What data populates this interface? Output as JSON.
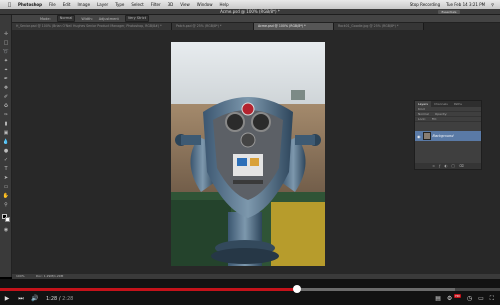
{
  "mac_menu": {
    "apple_icon": "apple-icon",
    "app_name": "Photoshop",
    "items": [
      "File",
      "Edit",
      "Image",
      "Layer",
      "Type",
      "Select",
      "Filter",
      "3D",
      "View",
      "Window",
      "Help"
    ],
    "clock": "Tue Feb 14  3:21 PM",
    "recording_label": "Stop Recording"
  },
  "app_bar": {
    "document_title": "Acme.psd @ 100% (RGB/8*) *",
    "workspace": "Essentials"
  },
  "options_bar": {
    "mode_label": "Mode:",
    "mode_value": "Normal",
    "width_label": "Width:",
    "adjustment_label": "Adjustment",
    "adjustment_value": "Very Strict"
  },
  "tabs": [
    {
      "label": "H_Senior.psd @ 100% (Brian O'Neil Hughes Senior Product Manager, Photoshop, RGB/8#) *",
      "active": false
    },
    {
      "label": "Patch.psd @ 25% (RGB/8*) *",
      "active": false
    },
    {
      "label": "Acme.psd @ 100% (RGB/8*) *",
      "active": true
    },
    {
      "label": "Rock01_Goodie.jpg @ 25% (RGB/8*) *",
      "active": false
    }
  ],
  "layers_panel": {
    "tabs": [
      "Layers",
      "Channels",
      "Paths"
    ],
    "kind_label": "Kind",
    "blend_mode": "Normal",
    "opacity_label": "Opacity:",
    "lock_label": "Lock:",
    "fill_label": "Fill:",
    "layer_name": "Background"
  },
  "status_bar": {
    "zoom": "100%",
    "doc_info": "Doc: 1.29M/1.29M"
  },
  "player": {
    "current_time": "1:28",
    "duration": "2:28",
    "progress": 0.594,
    "buffered": 0.91,
    "hd_label": "HD",
    "icons": [
      "play-icon",
      "next-icon",
      "volume-icon",
      "captions-icon",
      "settings-icon",
      "watch-later-icon",
      "theater-icon",
      "fullscreen-icon"
    ]
  },
  "colors": {
    "accent": "#c4121a",
    "panel": "#3a3a3a",
    "canvas": "#282828",
    "layer_selected": "#5a7aa6"
  }
}
